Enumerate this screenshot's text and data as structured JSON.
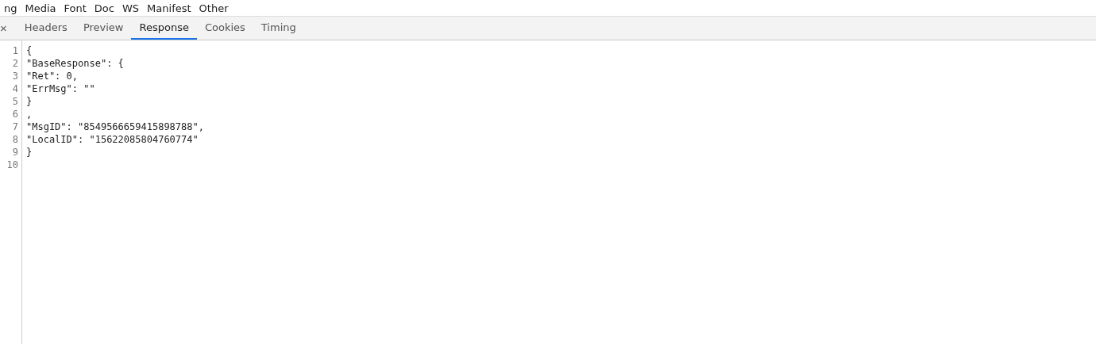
{
  "filters": [
    {
      "label": "ng"
    },
    {
      "label": "Media"
    },
    {
      "label": "Font"
    },
    {
      "label": "Doc"
    },
    {
      "label": "WS"
    },
    {
      "label": "Manifest"
    },
    {
      "label": "Other"
    }
  ],
  "close_glyph": "×",
  "tabs": [
    {
      "label": "Headers",
      "selected": false
    },
    {
      "label": "Preview",
      "selected": false
    },
    {
      "label": "Response",
      "selected": true
    },
    {
      "label": "Cookies",
      "selected": false
    },
    {
      "label": "Timing",
      "selected": false
    }
  ],
  "lines": [
    {
      "number": "1",
      "text": "{"
    },
    {
      "number": "2",
      "text": "\"BaseResponse\": {"
    },
    {
      "number": "3",
      "text": "\"Ret\": 0,"
    },
    {
      "number": "4",
      "text": "\"ErrMsg\": \"\""
    },
    {
      "number": "5",
      "text": "}"
    },
    {
      "number": "6",
      "text": ","
    },
    {
      "number": "7",
      "text": "\"MsgID\": \"8549566659415898788\","
    },
    {
      "number": "8",
      "text": "\"LocalID\": \"15622085804760774\""
    },
    {
      "number": "9",
      "text": "}"
    },
    {
      "number": "10"
    }
  ]
}
